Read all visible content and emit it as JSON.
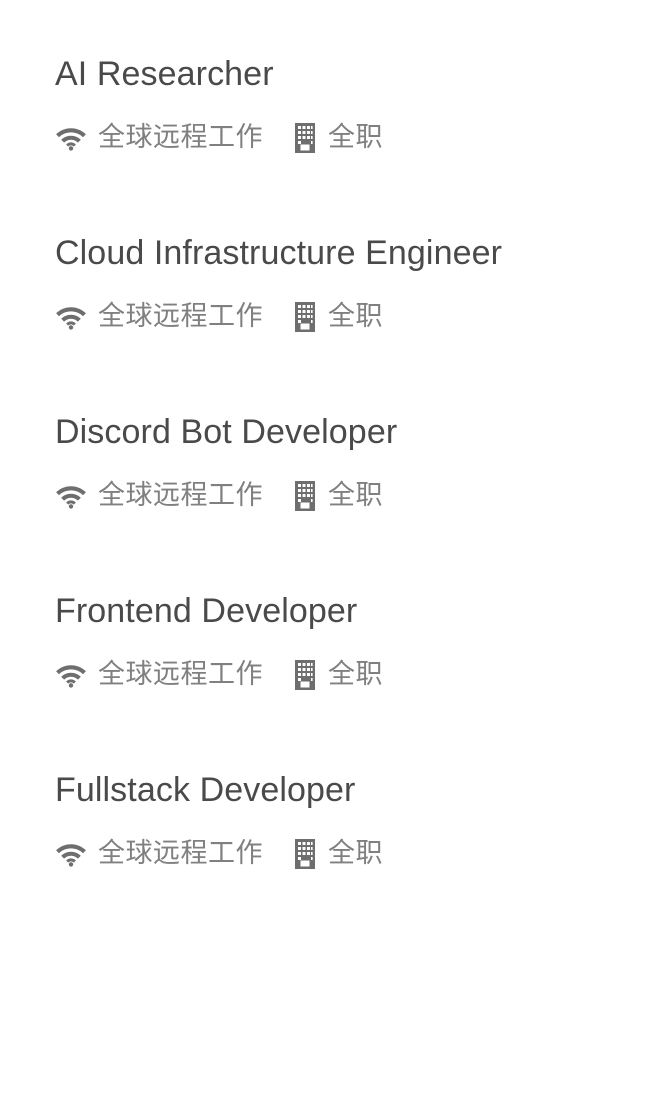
{
  "page": {
    "background": "#ffffff",
    "title_color": "#4a4a4a",
    "meta_color": "#808080",
    "icon_color": "#6e6e6e"
  },
  "icons": {
    "remote": "wifi-icon",
    "employment": "building-icon"
  },
  "jobs": [
    {
      "title": "AI Researcher",
      "location": "全球远程工作",
      "employment_type": "全职"
    },
    {
      "title": "Cloud Infrastructure Engineer",
      "location": "全球远程工作",
      "employment_type": "全职"
    },
    {
      "title": "Discord Bot Developer",
      "location": "全球远程工作",
      "employment_type": "全职"
    },
    {
      "title": "Frontend Developer",
      "location": "全球远程工作",
      "employment_type": "全职"
    },
    {
      "title": "Fullstack Developer",
      "location": "全球远程工作",
      "employment_type": "全职"
    }
  ]
}
